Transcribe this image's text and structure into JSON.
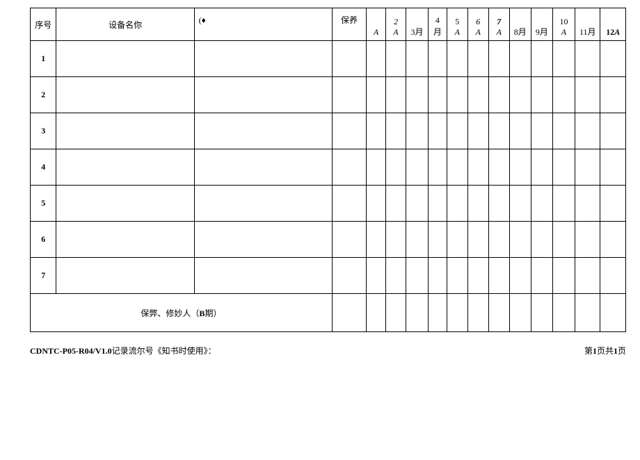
{
  "headers": {
    "seq": "序号",
    "name": "设备名你",
    "symbol": "(♦",
    "maint": "保养",
    "m1": "A",
    "m2_top": "2",
    "m2_bot": "A",
    "m3": "3月",
    "m4_top": "4",
    "m4_bot": "月",
    "m5_top": "5",
    "m5_bot": "A",
    "m6_top": "6",
    "m6_bot": "A",
    "m7_top": "7",
    "m7_bot": "A",
    "m8": "8月",
    "m9": "9月",
    "m10_top": "10",
    "m10_bot": "A",
    "m11": "11月",
    "m12": "12A"
  },
  "rows": [
    "1",
    "2",
    "3",
    "4",
    "5",
    "6",
    "7"
  ],
  "footer_label_prefix": "保弊、修妙人（",
  "footer_label_bold": "B",
  "footer_label_suffix": "期）",
  "bottom": {
    "code": "CDNTC-P05-R04/V1.0",
    "record_text": "记录流尔号《知书时使用》：",
    "page_prefix": "第",
    "page_num1": "1",
    "page_mid": "页共",
    "page_num2": "1",
    "page_suffix": "页"
  }
}
